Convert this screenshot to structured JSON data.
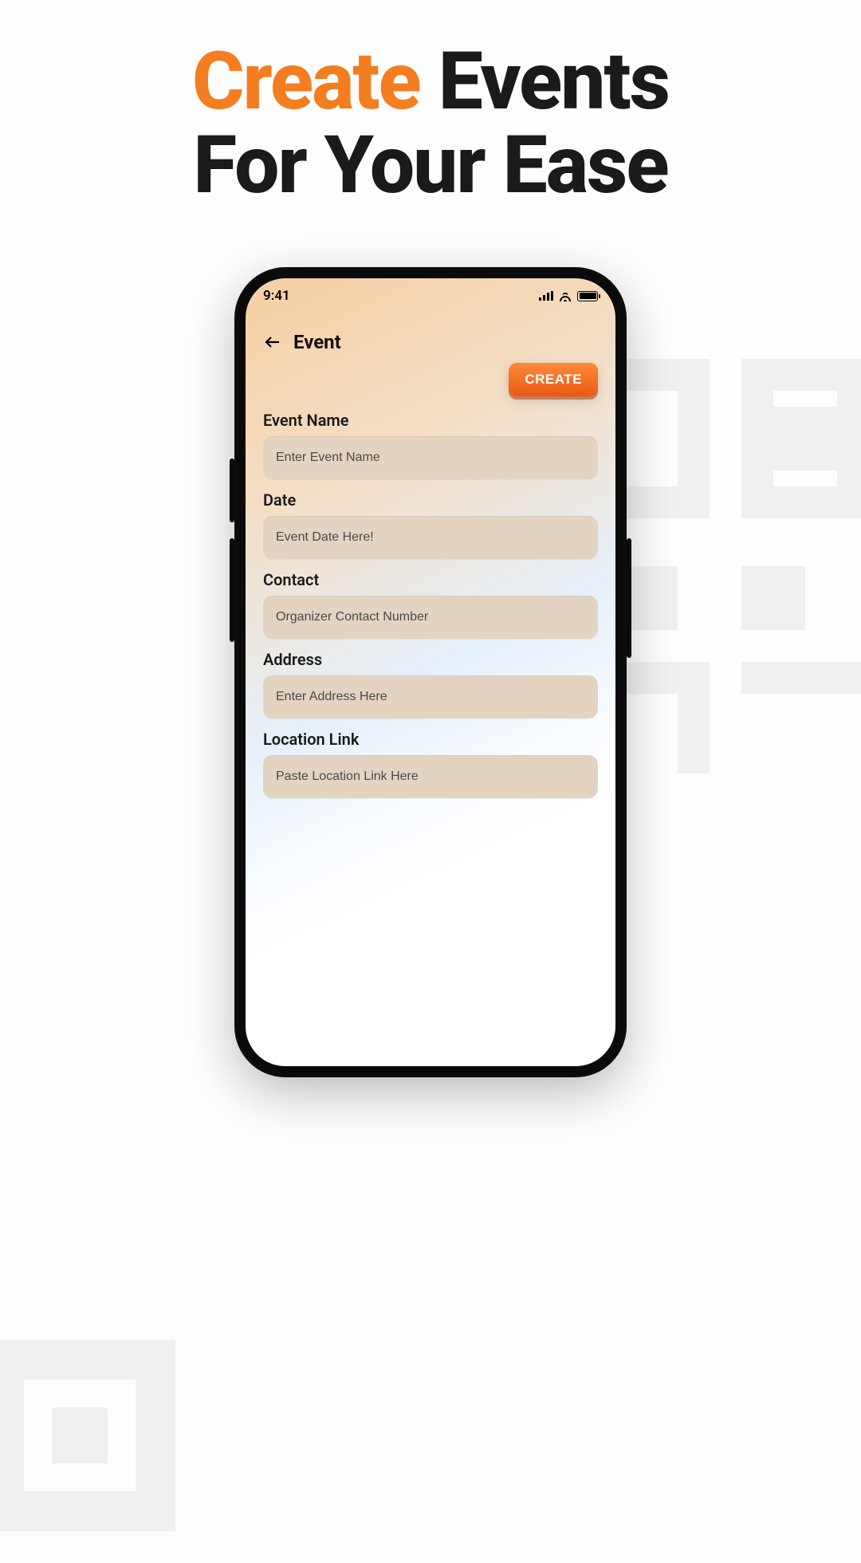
{
  "headline": {
    "word1": "Create",
    "word2": "Events",
    "line2": "For Your Ease"
  },
  "statusbar": {
    "time": "9:41"
  },
  "header": {
    "title": "Event"
  },
  "actions": {
    "create_label": "CREATE"
  },
  "form": {
    "fields": [
      {
        "label": "Event Name",
        "placeholder": "Enter Event Name",
        "value": ""
      },
      {
        "label": "Date",
        "placeholder": "Event Date Here!",
        "value": ""
      },
      {
        "label": "Contact",
        "placeholder": "Organizer Contact Number",
        "value": ""
      },
      {
        "label": "Address",
        "placeholder": "Enter Address Here",
        "value": ""
      },
      {
        "label": "Location Link",
        "placeholder": "Paste Location Link Here",
        "value": ""
      }
    ]
  },
  "colors": {
    "accent": "#f47d20"
  }
}
